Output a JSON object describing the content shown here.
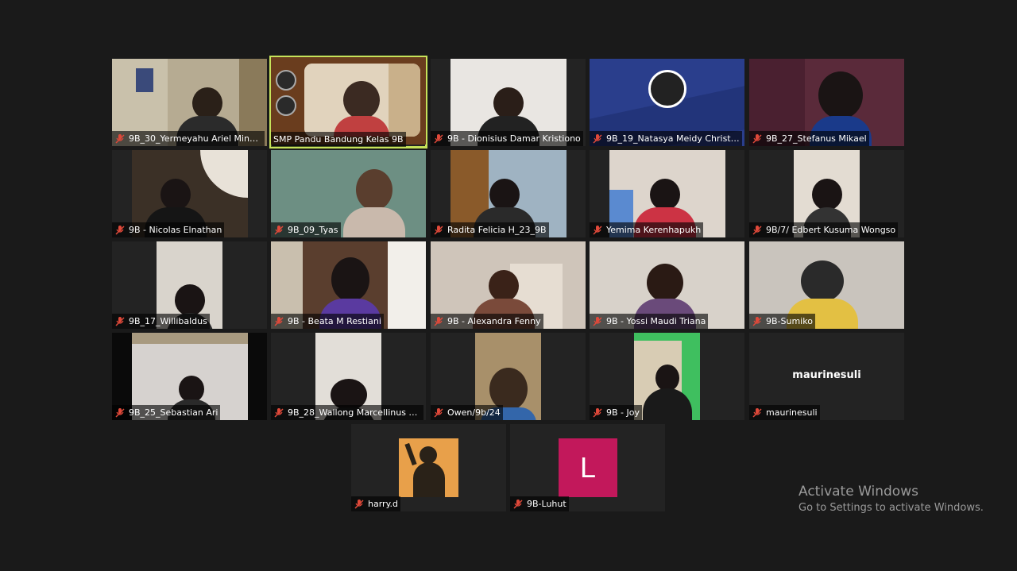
{
  "participants": [
    {
      "name": "9B_30_Yermeyahu Ariel Minwa...",
      "bg": "#8a8270",
      "video": "#b6ab92",
      "shirt": "#2b2b2b",
      "muted": true
    },
    {
      "name": "SMP Pandu Bandung Kelas 9B",
      "bg": "#6a3d1e",
      "video": "#d7c8b4",
      "shirt": "#c04040",
      "muted": false,
      "speaking": true
    },
    {
      "name": "9B - Dionisius Damar Kristiono",
      "bg": "#232323",
      "video": "#e9e6e2",
      "shirt": "#222222",
      "muted": true
    },
    {
      "name": "9B_19_Natasya Meidy Christa...",
      "bg": "#2a3e8c",
      "video": "#2a3e8c",
      "shirt": "#2a3e8c",
      "muted": true
    },
    {
      "name": "9B_27_Stefanus Mikael",
      "bg": "#3a1f2a",
      "video": "#5a2a3a",
      "shirt": "#1a3a8a",
      "muted": true
    },
    {
      "name": "9B - Nicolas Elnathan",
      "bg": "#232323",
      "video": "#3b3026",
      "shirt": "#151515",
      "muted": true
    },
    {
      "name": "9B_09_Tyas",
      "bg": "#6d8f83",
      "video": "#6d8f83",
      "shirt": "#c9b9ac",
      "muted": true
    },
    {
      "name": "Radita Felicia H_23_9B",
      "bg": "#232323",
      "video": "#9fb3c2",
      "shirt": "#2a2a2a",
      "muted": true
    },
    {
      "name": "Yemima Kerenhapukh",
      "bg": "#232323",
      "video": "#ddd5cc",
      "shirt": "#cc3344",
      "muted": true
    },
    {
      "name": "9B/7/ Edbert Kusuma Wongso",
      "bg": "#232323",
      "video": "#e3dcd2",
      "shirt": "#333333",
      "muted": true
    },
    {
      "name": "9B_17_Willibaldus",
      "bg": "#232323",
      "video": "#d9d4cc",
      "shirt": "#2a2a2a",
      "muted": true
    },
    {
      "name": "9B - Beata M Restiani",
      "bg": "#3a2a22",
      "video": "#5a3e2e",
      "shirt": "#5a3aa0",
      "muted": true
    },
    {
      "name": "9B - Alexandra Fenny",
      "bg": "#cfc5ba",
      "video": "#cfc5ba",
      "shirt": "#7a4a3a",
      "muted": true
    },
    {
      "name": "9B - Yossi Maudi Triana",
      "bg": "#d8d2ca",
      "video": "#d8d2ca",
      "shirt": "#6a4a7a",
      "muted": true
    },
    {
      "name": "9B-Sumiko",
      "bg": "#c9c4bd",
      "video": "#c9c4bd",
      "shirt": "#e3c043",
      "muted": true
    },
    {
      "name": "9B_25_Sebastian Ari",
      "bg": "#0a0a0a",
      "video": "#d6d2cf",
      "shirt": "#2a2a2a",
      "muted": true
    },
    {
      "name": "9B_28_Wallong Marcellinus Ca...",
      "bg": "#232323",
      "video": "#e2ded8",
      "shirt": "#1f1f1f",
      "muted": true
    },
    {
      "name": "Owen/9b/24",
      "bg": "#232323",
      "video": "#a8906a",
      "shirt": "#3366aa",
      "muted": true
    },
    {
      "name": "9B - Joy",
      "bg": "#232323",
      "video": "#3fbf5f",
      "shirt": "#1a1a1a",
      "muted": true
    },
    {
      "name": "maurinesuli",
      "bg": "#232323",
      "video": "#232323",
      "shirt": "#232323",
      "muted": true,
      "center_name": "maurinesuli"
    },
    {
      "name": "harry.d",
      "bg": "#232323",
      "video": "#e8a04a",
      "shirt": "#2a2218",
      "muted": true
    },
    {
      "name": "9B-Luhut",
      "bg": "#232323",
      "video": "#c2185b",
      "shirt": "#c2185b",
      "muted": true,
      "avatar_letter": "L"
    }
  ],
  "watermark": {
    "title": "Activate Windows",
    "subtitle": "Go to Settings to activate Windows."
  },
  "colors": {
    "active_speaker": "#c6e35a",
    "mute_icon": "#e0493a",
    "avatar": "#c2185b"
  }
}
